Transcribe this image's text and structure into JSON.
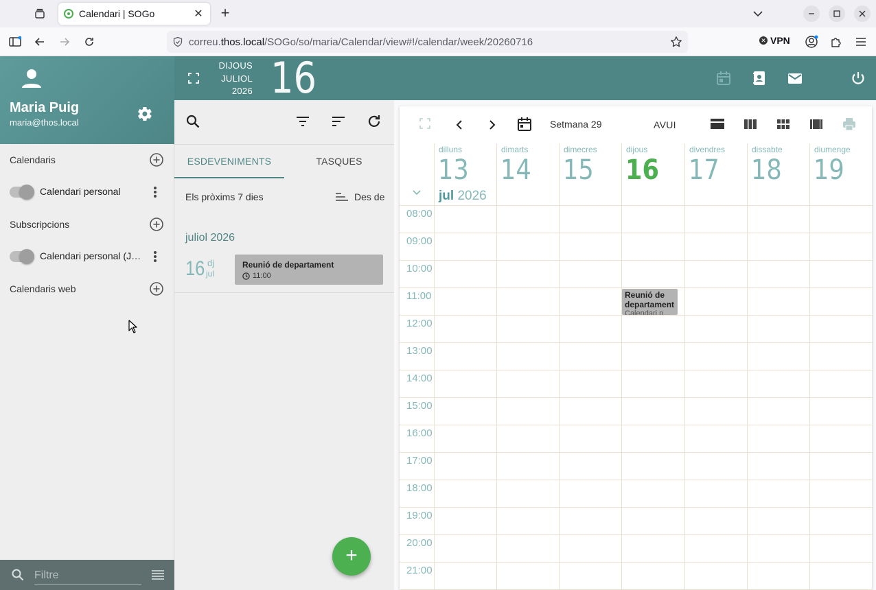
{
  "browser": {
    "tab_title": "Calendari | SOGo",
    "url_prefix": "correu.",
    "url_host": "thos.local",
    "url_path": "/SOGo/so/maria/Calendar/view#!/calendar/week/20260716",
    "vpn_label": "VPN"
  },
  "user": {
    "name": "Maria Puig",
    "email": "maria@thos.local"
  },
  "sidebar": {
    "calendars_title": "Calendaris",
    "calendars": [
      {
        "label": "Calendari personal"
      }
    ],
    "subscriptions_title": "Subscripcions",
    "subscriptions": [
      {
        "label": "Calendari personal (Jordi Thos)"
      }
    ],
    "web_title": "Calendaris web",
    "filter_placeholder": "Filtre"
  },
  "header": {
    "weekday": "DIJOUS",
    "month": "JULIOL",
    "year": "2026",
    "day": "16"
  },
  "list": {
    "tab_events": "ESDEVENIMENTS",
    "tab_tasks": "TASQUES",
    "range": "Els pròxims 7 dies",
    "sort": "Des de",
    "month_heading": "juliol 2026",
    "events": [
      {
        "day": "16",
        "dow": "dj",
        "mon": "jul",
        "title": "Reunió de departament",
        "time": "11:00"
      }
    ]
  },
  "calendar": {
    "week_label": "Setmana 29",
    "today_label": "AVUI",
    "month_label": "jul",
    "year_label": "2026",
    "days": [
      {
        "name": "dilluns",
        "num": "13"
      },
      {
        "name": "dimarts",
        "num": "14"
      },
      {
        "name": "dimecres",
        "num": "15"
      },
      {
        "name": "dijous",
        "num": "16"
      },
      {
        "name": "divendres",
        "num": "17"
      },
      {
        "name": "dissabte",
        "num": "18"
      },
      {
        "name": "diumenge",
        "num": "19"
      }
    ],
    "hours": [
      "08:00",
      "09:00",
      "10:00",
      "11:00",
      "12:00",
      "13:00",
      "14:00",
      "15:00",
      "16:00",
      "17:00",
      "18:00",
      "19:00",
      "20:00",
      "21:00"
    ],
    "event": {
      "title": "Reunió de departament",
      "calendar": "Calendari p..."
    }
  },
  "colors": {
    "primary": "#4e8585",
    "accent": "#4caf50",
    "event_bg": "#b3b3b3"
  }
}
